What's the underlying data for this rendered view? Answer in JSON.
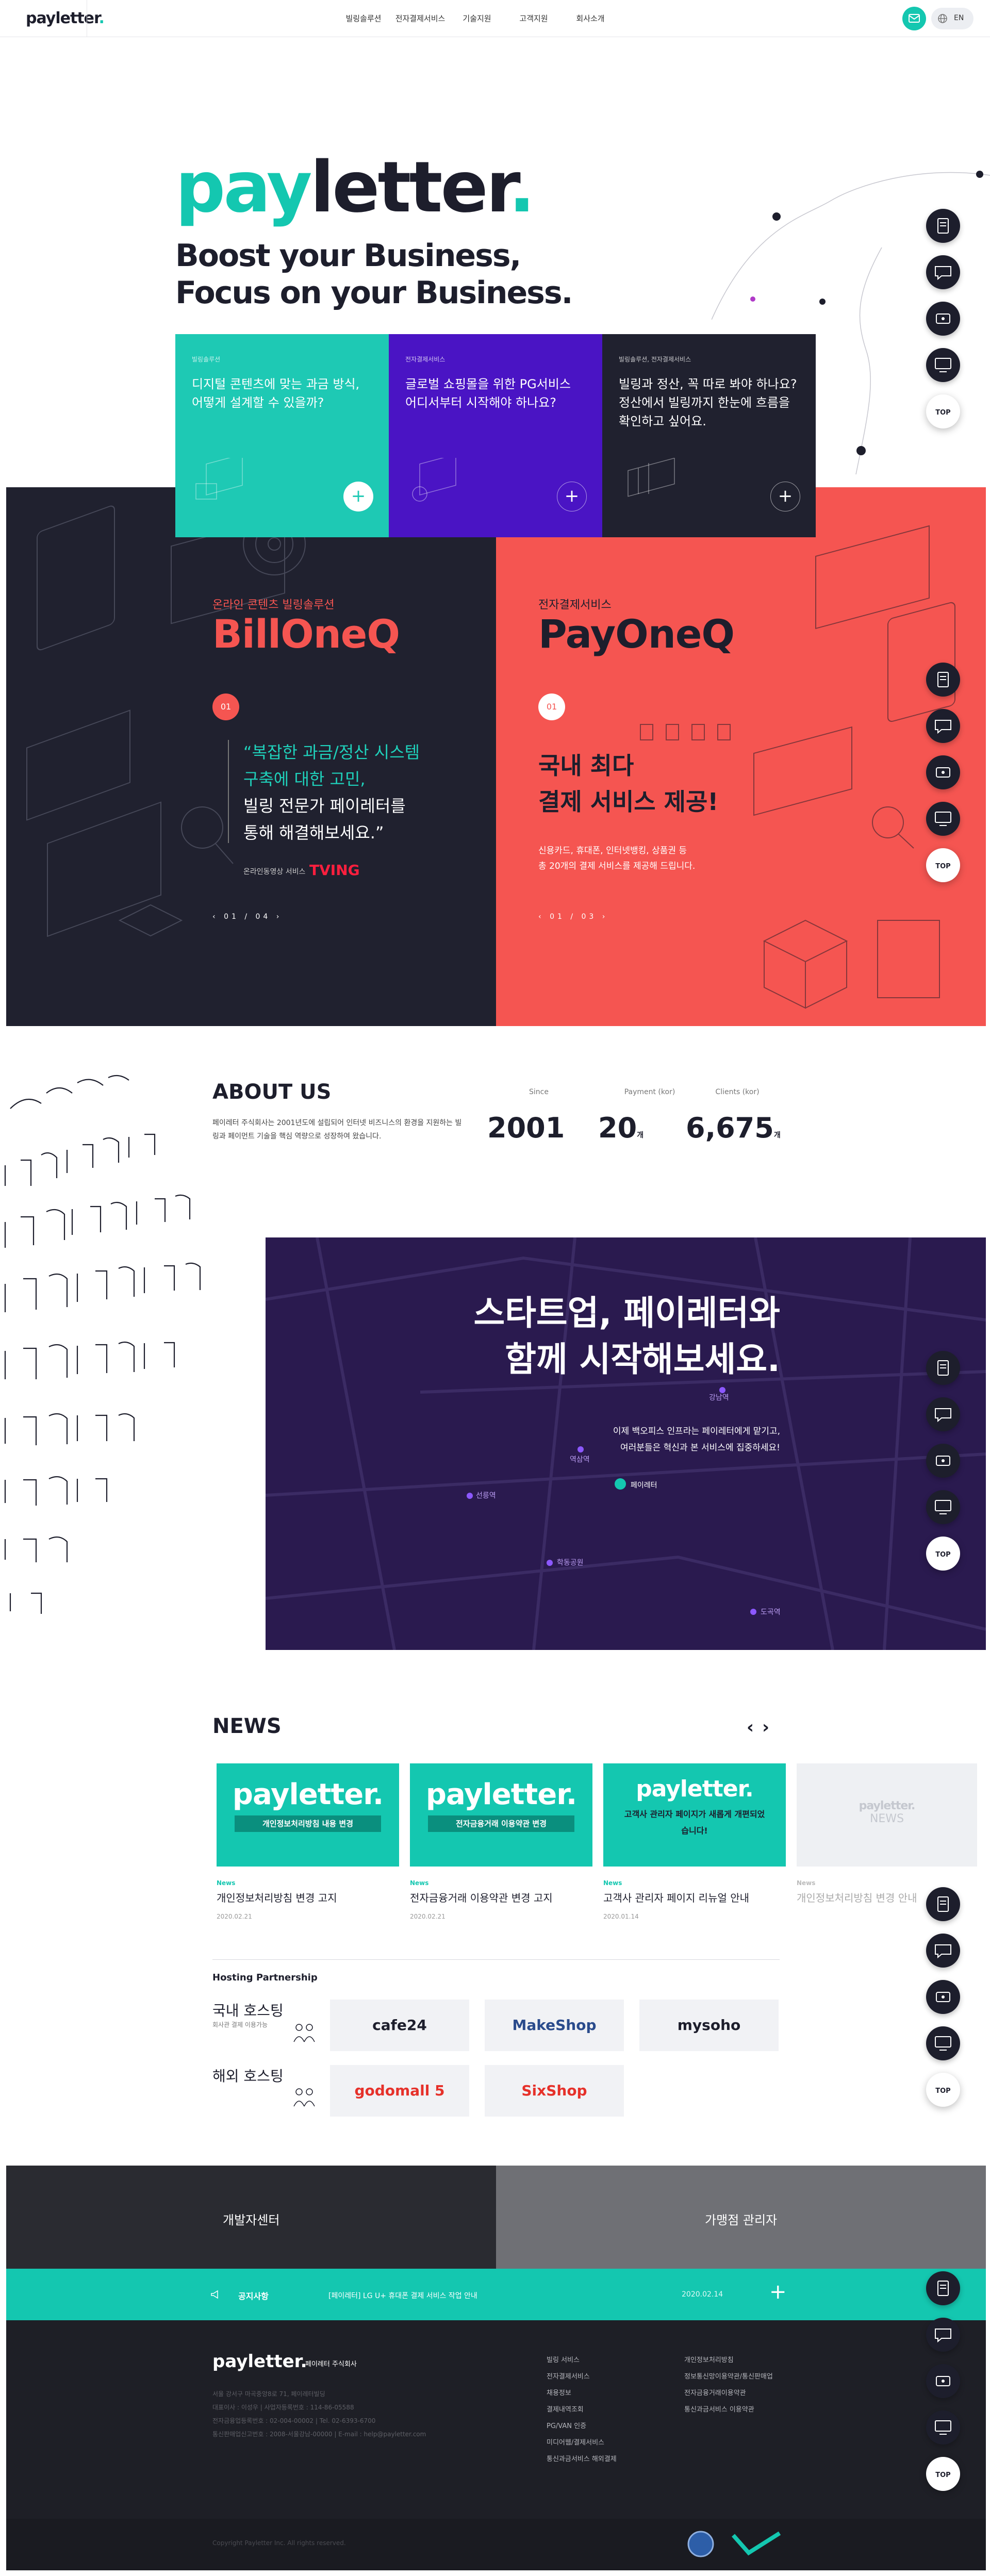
{
  "header": {
    "logo_a": "pay",
    "logo_b": "letter",
    "logo_c": ".",
    "nav": [
      "빌링솔루션",
      "전자결제서비스",
      "기술지원",
      "고객지원",
      "회사소개"
    ],
    "lang": "EN"
  },
  "hero": {
    "logo_a": "pay",
    "logo_b": "letter",
    "logo_c": ".",
    "line1": "Boost your Business,",
    "line2": "Focus on your Business."
  },
  "cards": [
    {
      "small": "빌링솔루션",
      "text": "디지털 콘텐츠에 맞는 과금 방식, 어떻게 설계할 수 있을까?",
      "color": "#1ec9b4"
    },
    {
      "small": "전자결제서비스",
      "text": "글로벌 쇼핑몰을 위한 PG서비스 어디서부터 시작해야 하나요?",
      "color": "#4a14c4"
    },
    {
      "small": "빌링솔루션, 전자결제서비스",
      "text": "빌링과 정산, 꼭 따로 봐야 하나요? 정산에서 빌링까지 한눈에 흐름을 확인하고 싶어요.",
      "color": "#20212f"
    }
  ],
  "billone": {
    "kicker": "온라인 콘텐츠 빌링솔루션",
    "brand": "BillOneQ",
    "num": "01",
    "q1": "“복잡한 과금/정산 시스템",
    "q2": "구축에 대한 고민,",
    "q3": "빌링 전문가 페이레터를",
    "q4": "통해 해결해보세요.”",
    "client": "온라인동영상 서비스",
    "client_logo": "TVING",
    "pager": "01 / 04"
  },
  "payone": {
    "kicker": "전자결제서비스",
    "brand": "PayOneQ",
    "num": "01",
    "h1": "국내 최다",
    "h2": "결제 서비스 제공!",
    "d1": "신용카드, 휴대폰, 인터넷뱅킹, 상품권 등",
    "d2": "총 20개의 결제 서비스를 제공해 드립니다.",
    "pager": "01 / 03"
  },
  "about": {
    "title": "ABOUT US",
    "desc": "페이레터 주식회사는 2001년도에 설립되어 인터넷 비즈니스의 환경을 지원하는 빌링과 페이먼트 기술을 핵심 역량으로 성장하여 왔습니다.",
    "stats": [
      {
        "label": "Since",
        "value": "2001",
        "unit": ""
      },
      {
        "label": "Payment (kor)",
        "value": "20",
        "unit": "개"
      },
      {
        "label": "Clients (kor)",
        "value": "6,675",
        "unit": "개"
      }
    ]
  },
  "startup": {
    "l1": "스타트업, 페이레터와",
    "l2": "함께 시작해보세요.",
    "d1": "이제 백오피스 인프라는 페이레터에게 맡기고,",
    "d2": "여러분들은 혁신과 본 서비스에 집중하세요!",
    "places": [
      "강남역",
      "역삼역",
      "선릉역",
      "페이레터",
      "학동공원",
      "도곡역"
    ]
  },
  "news": {
    "title": "NEWS",
    "items": [
      {
        "logo": "payletter.",
        "banner": "개인정보처리방침 내용 변경",
        "tag": "News",
        "title": "개인정보처리방침 변경 고지",
        "date": "2020.02.21"
      },
      {
        "logo": "payletter.",
        "banner": "전자금융거래 이용약관 변경",
        "tag": "News",
        "title": "전자금융거래 이용약관 변경 고지",
        "date": "2020.02.21"
      },
      {
        "logo": "payletter.",
        "banner": "고객사 관리자 페이지가 새롭게 개편되었습니다!",
        "tag": "News",
        "title": "고객사 관리자 페이지 리뉴얼 안내",
        "date": "2020.01.14"
      },
      {
        "logo": "payletter.",
        "banner": "NEWS",
        "tag": "News",
        "title": "개인정보처리방침 변경 안내",
        "date": ""
      }
    ]
  },
  "hosting": {
    "title": "Hosting Partnership",
    "domestic": "국내 호스팅",
    "domestic_sub": "회사관 결제 이용가능",
    "overseas": "해외 호스팅",
    "partners": [
      "cafe24",
      "MakeShop",
      "mysoho",
      "godomall 5",
      "SixShop"
    ]
  },
  "bands": {
    "dev": "개발자센터",
    "mgr": "가맹점 관리자"
  },
  "notice": {
    "label": "공지사항",
    "text": "[페이레터] LG U+ 휴대폰 결제 서비스 작업 안내",
    "date": "2020.02.14"
  },
  "footer": {
    "logo": "payletter.",
    "company": "페이레터 주식회사",
    "addr": [
      "서울 강서구 마곡중앙8로 71, 페이레터빌딩",
      "대표이사 : 이성우 | 사업자등록번호 : 114-86-05588",
      "전자금융업등록번호 : 02-004-00002 | Tel. 02-6393-6700",
      "통신판매업신고번호 : 2008-서울강남-00000 | E-mail : help@payletter.com"
    ],
    "menu1": [
      "빌링 서비스",
      "전자결제서비스",
      "채용정보",
      "결제내역조회",
      "PG/VAN 인증",
      "미디어웹/결제서비스",
      "통신과금서비스 해외결제"
    ],
    "menu2": [
      "개인정보처리방침",
      "정보통신망이용약관/통신판매업",
      "전자금융거래이용약관",
      "통신과금서비스 이용약관"
    ],
    "copy": "Copyright Payletter Inc. All rights reserved."
  },
  "float": {
    "top": "TOP",
    "icons": [
      "document-icon",
      "chat-icon",
      "login-icon",
      "monitor-icon"
    ]
  }
}
